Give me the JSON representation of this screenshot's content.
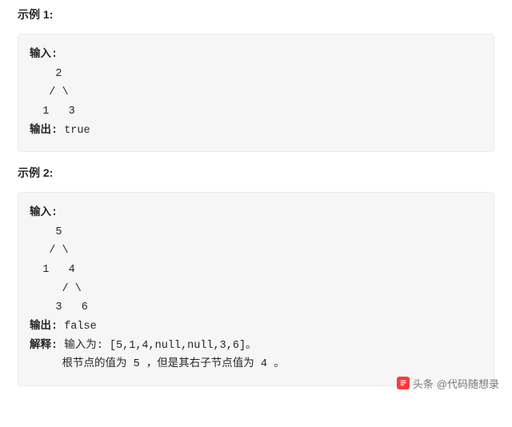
{
  "examples": [
    {
      "heading": "示例 1:",
      "input_label": "输入:",
      "tree": "    2\n   / \\\n  1   3",
      "output_label": "输出:",
      "output_value": " true"
    },
    {
      "heading": "示例 2:",
      "input_label": "输入:",
      "tree": "    5\n   / \\\n  1   4\n     / \\\n    3   6",
      "output_label": "输出:",
      "output_value": " false",
      "explain_label": "解释:",
      "explain_line1": " 输入为: [5,1,4,null,null,3,6]。",
      "explain_line2": "     根节点的值为 5 ，但是其右子节点值为 4 。"
    }
  ],
  "watermark": {
    "prefix": "头条",
    "at": " @代码随想录"
  }
}
